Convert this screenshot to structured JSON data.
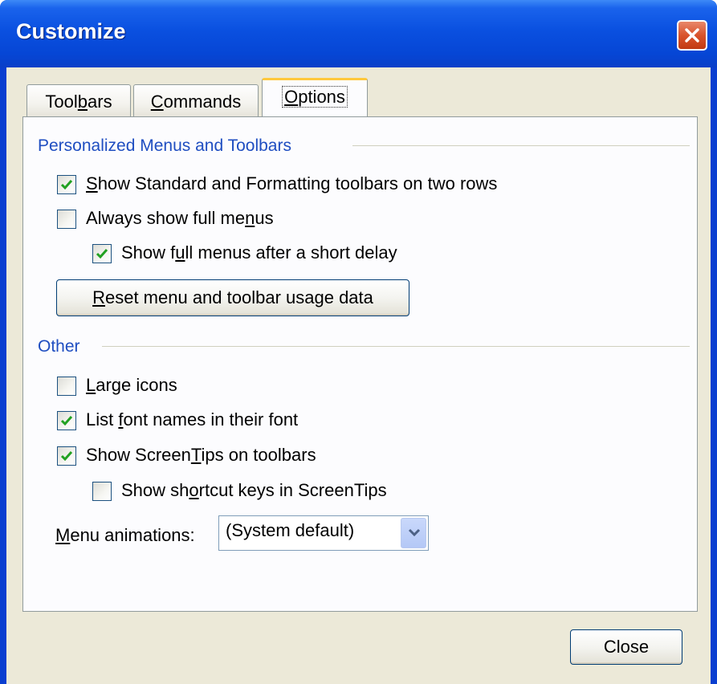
{
  "window": {
    "title": "Customize",
    "close_icon": "close-icon",
    "accent_color": "#0a50e0"
  },
  "tabs": [
    {
      "label_pre": "Tool",
      "mnemonic": "b",
      "label_post": "ars",
      "active": false
    },
    {
      "label_pre": "",
      "mnemonic": "C",
      "label_post": "ommands",
      "active": false
    },
    {
      "label_pre": "",
      "mnemonic": "O",
      "label_post": "ptions",
      "active": true
    }
  ],
  "personalized": {
    "heading": "Personalized Menus and Toolbars",
    "options": [
      {
        "pre": "",
        "mnemonic": "S",
        "post": "how Standard and Formatting toolbars on two rows",
        "checked": true
      },
      {
        "pre": "Always show full me",
        "mnemonic": "n",
        "post": "us",
        "checked": false
      },
      {
        "pre": "Show f",
        "mnemonic": "u",
        "post": "ll menus after a short delay",
        "checked": true
      }
    ],
    "reset_button": {
      "pre": "",
      "mnemonic": "R",
      "post": "eset menu and toolbar usage data"
    }
  },
  "other": {
    "heading": "Other",
    "options": [
      {
        "pre": "",
        "mnemonic": "L",
        "post": "arge icons",
        "checked": false
      },
      {
        "pre": "List ",
        "mnemonic": "f",
        "post": "ont names in their font",
        "checked": true
      },
      {
        "pre": "Show Screen",
        "mnemonic": "T",
        "post": "ips on toolbars",
        "checked": true
      },
      {
        "pre": "Show sh",
        "mnemonic": "o",
        "post": "rtcut keys in ScreenTips",
        "checked": false
      }
    ],
    "menu_animations": {
      "label_pre": "",
      "mnemonic": "M",
      "label_post": "enu animations:",
      "value": "(System default)"
    }
  },
  "footer": {
    "close_button": "Close"
  }
}
